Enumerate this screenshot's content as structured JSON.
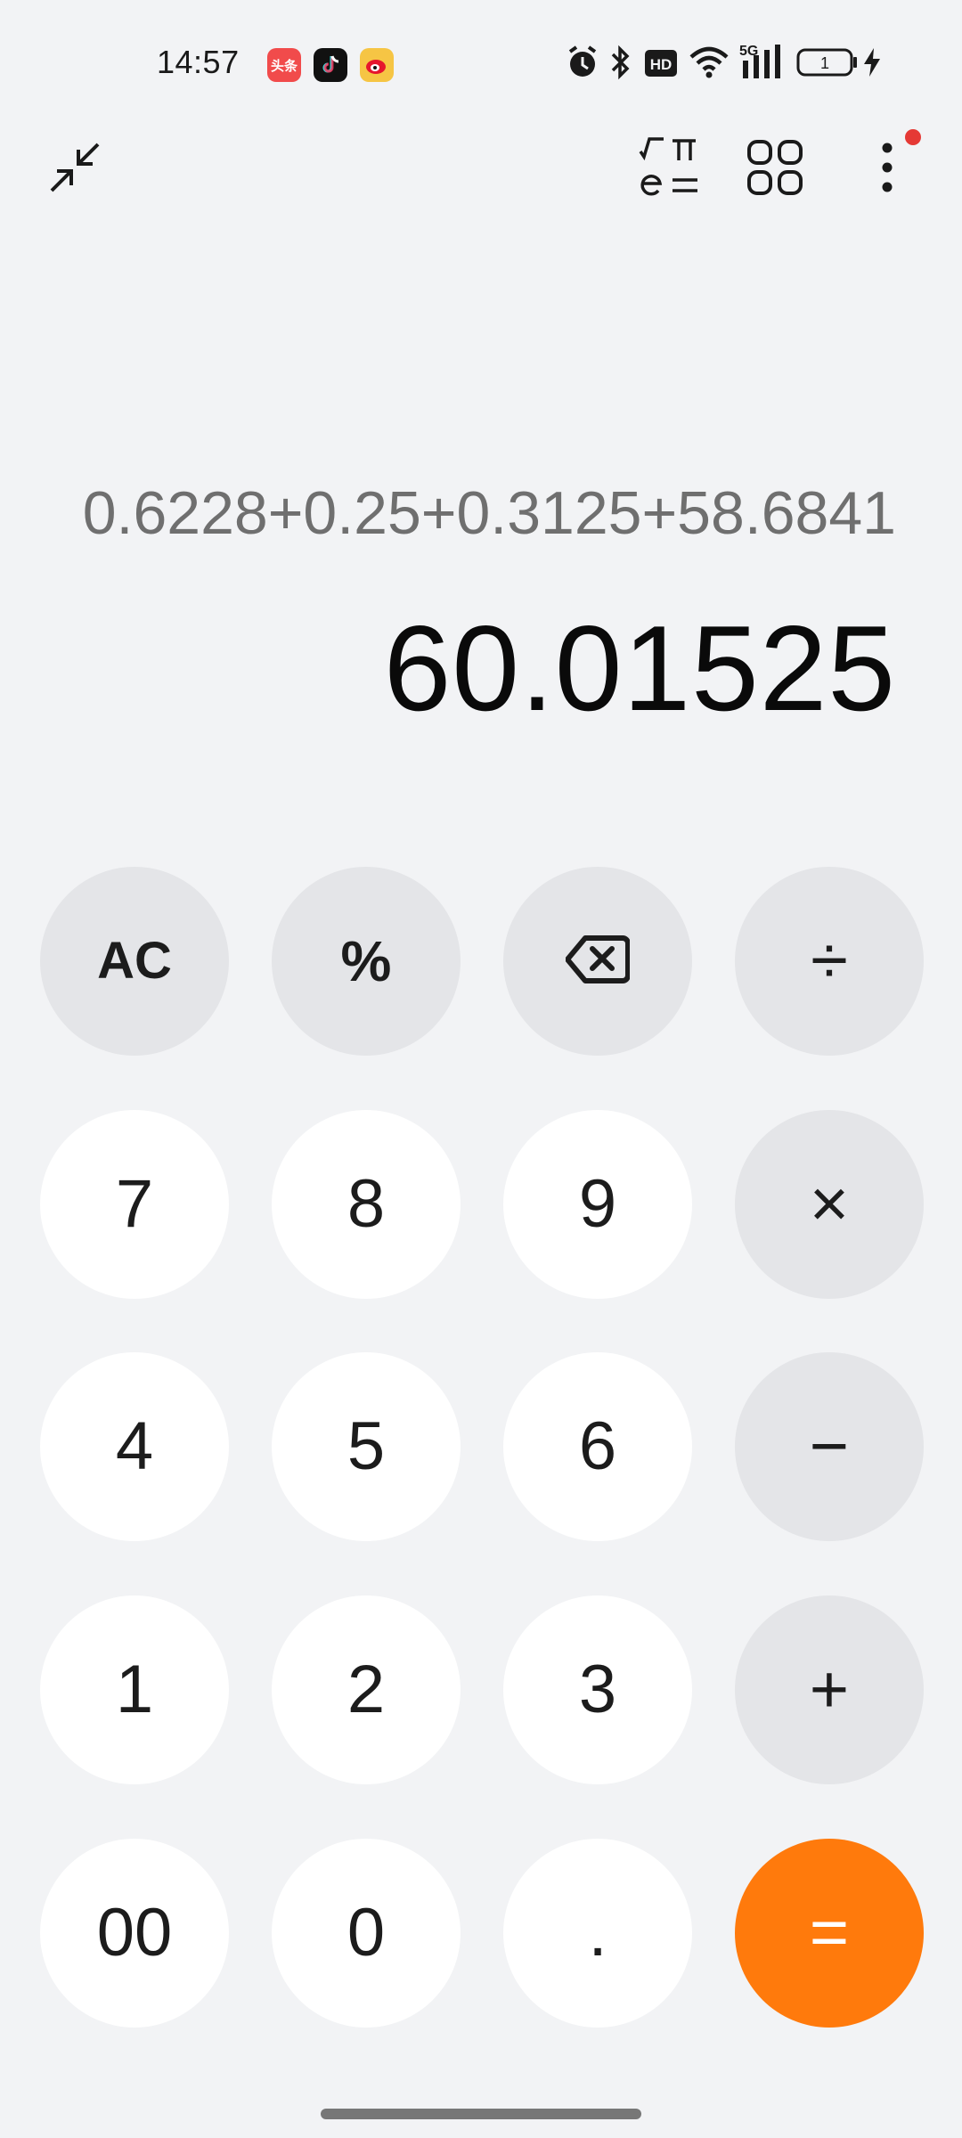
{
  "status_bar": {
    "time": "14:57",
    "toutiao_badge": "头条",
    "network": "5G",
    "battery_level": "1"
  },
  "toolbar": {
    "collapse_icon": "collapse-icon",
    "scientific_icon": "scientific-mode-icon",
    "grid_icon": "grid-icon",
    "more_icon": "more-vertical-icon",
    "notification_dot": true
  },
  "display": {
    "expression": "0.6228+0.25+0.3125+58.6841",
    "result": "60.01525"
  },
  "keypad": {
    "ac": "AC",
    "percent": "%",
    "divide": "÷",
    "seven": "7",
    "eight": "8",
    "nine": "9",
    "multiply": "×",
    "four": "4",
    "five": "5",
    "six": "6",
    "minus": "−",
    "one": "1",
    "two": "2",
    "three": "3",
    "plus": "+",
    "double_zero": "00",
    "zero": "0",
    "decimal": ".",
    "equals": "="
  },
  "colors": {
    "background": "#f2f3f5",
    "number_key": "#ffffff",
    "function_key": "#e4e5e8",
    "equals_key": "#ff7a0c",
    "notification_dot": "#e53935"
  }
}
